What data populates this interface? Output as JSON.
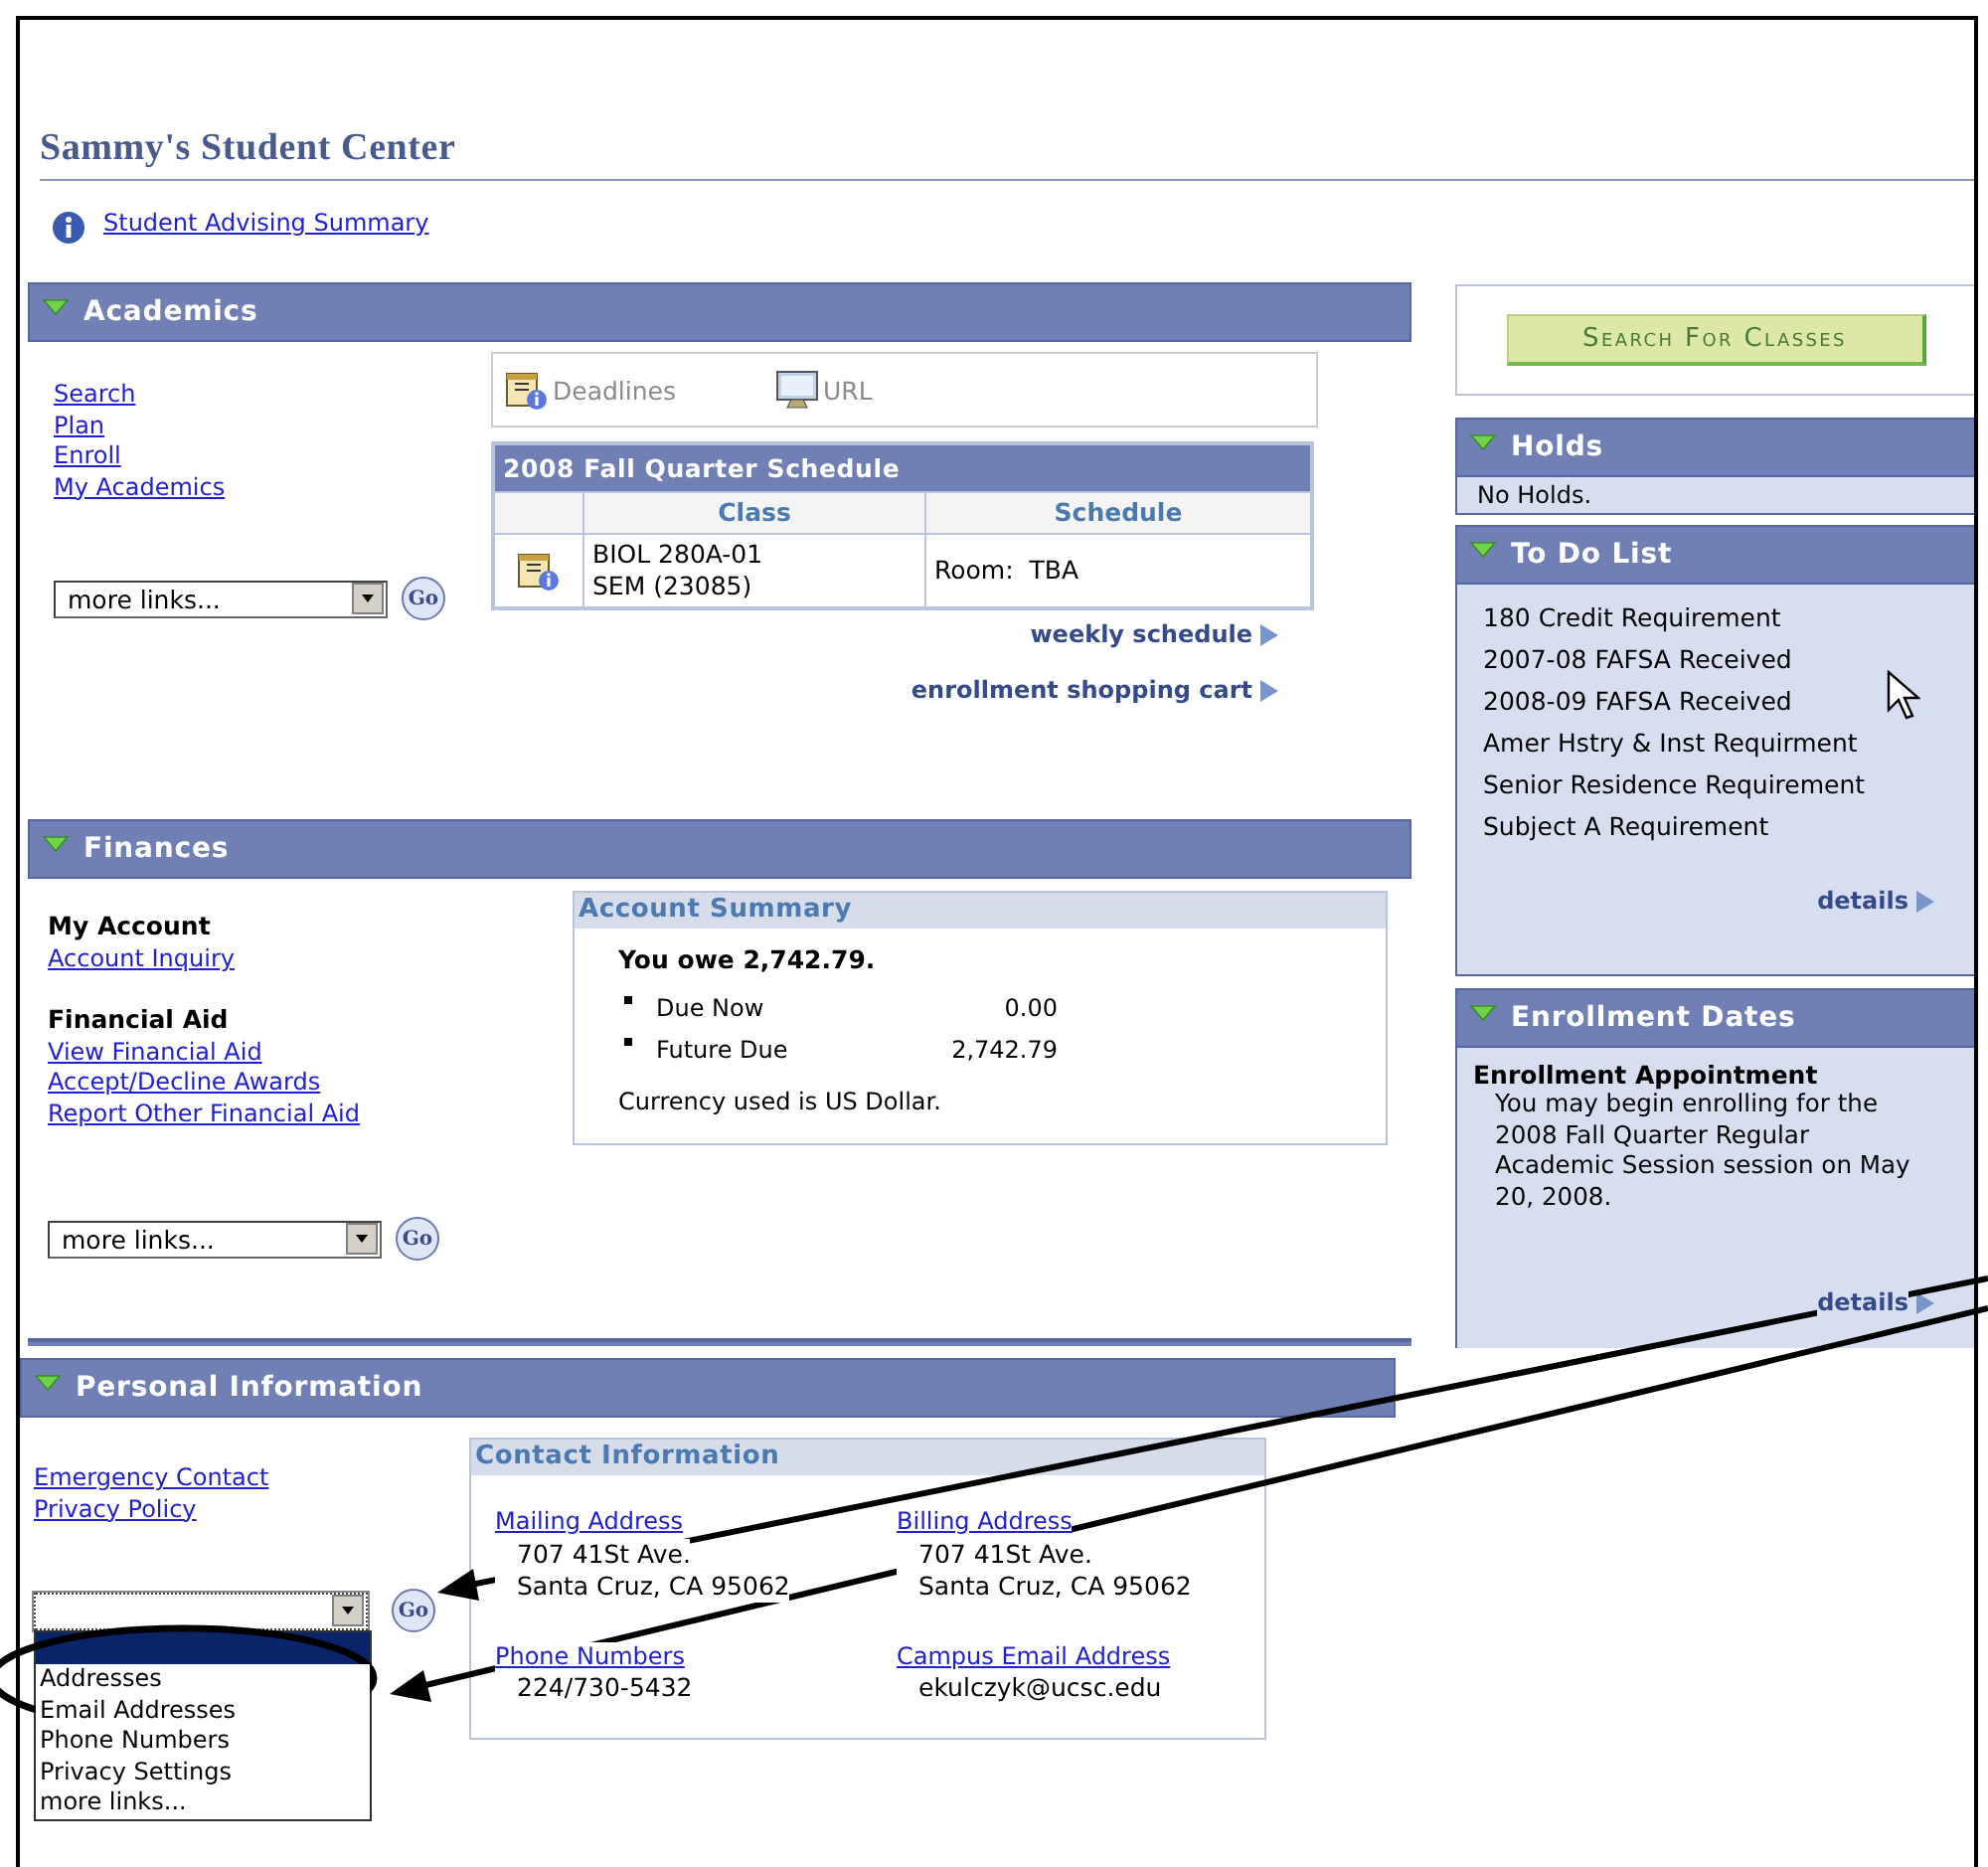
{
  "page_title": "Sammy's Student Center",
  "advising_link": "Student Advising Summary",
  "academics": {
    "title": "Academics",
    "expanded": true,
    "links": [
      "Search",
      "Plan",
      "Enroll",
      "My Academics"
    ],
    "more_links": "more links...",
    "go": "Go",
    "tools": [
      {
        "label": "Deadlines",
        "kind": "calendar"
      },
      {
        "label": "URL",
        "kind": "url"
      }
    ],
    "schedule": {
      "title": "2008 Fall Quarter Schedule",
      "columns": [
        "Class",
        "Schedule"
      ],
      "rows": [
        {
          "class": [
            "BIOL 280A-01",
            "SEM (23085)"
          ],
          "schedule": "Room:  TBA"
        }
      ]
    },
    "actions": [
      "weekly schedule",
      "enrollment shopping cart"
    ]
  },
  "finances": {
    "title": "Finances",
    "expanded": true,
    "groups": [
      {
        "heading": "My Account",
        "links": [
          "Account Inquiry"
        ]
      },
      {
        "heading": "Financial Aid",
        "links": [
          "View Financial Aid",
          "Accept/Decline Awards",
          "Report Other Financial Aid"
        ]
      }
    ],
    "more_links": "more links...",
    "go": "Go",
    "summary": {
      "title": "Account Summary",
      "owe": "You owe 2,742.79.",
      "items": [
        {
          "label": "Due Now",
          "amount": "0.00"
        },
        {
          "label": "Future Due",
          "amount": "2,742.79"
        }
      ],
      "note": "Currency used is US Dollar."
    }
  },
  "sidebar": {
    "search_button": "Search For Classes",
    "holds": {
      "title": "Holds",
      "expanded": true,
      "text": "No Holds."
    },
    "todo": {
      "title": "To Do List",
      "expanded": true,
      "items": [
        "180 Credit Requirement",
        "2007-08 FAFSA Received",
        "2008-09 FAFSA Received",
        "Amer Hstry & Inst Requirment",
        "Senior Residence Requirement",
        "Subject A Requirement"
      ],
      "details": "details"
    },
    "enrollment": {
      "title": "Enrollment Dates",
      "expanded": true,
      "heading": "Enrollment Appointment",
      "text": "You may begin enrolling for the 2008 Fall Quarter Regular Academic Session session on May 20, 2008.",
      "details": "details"
    }
  },
  "personal": {
    "title": "Personal Information",
    "expanded": true,
    "links": [
      "Emergency Contact",
      "Privacy Policy"
    ],
    "go": "Go",
    "dropdown": {
      "open": true,
      "blank_option_selected": true,
      "options": [
        {
          "label": "Addresses",
          "selected": false
        },
        {
          "label": "Email Addresses",
          "selected": false
        },
        {
          "label": "Phone Numbers",
          "selected": false
        },
        {
          "label": "Privacy Settings",
          "selected": false
        },
        {
          "label": "more links...",
          "selected": false
        }
      ]
    },
    "contact": {
      "title": "Contact Information",
      "entries": [
        {
          "label": "Mailing Address",
          "lines": [
            "707 41St Ave.",
            "Santa Cruz, CA 95062"
          ]
        },
        {
          "label": "Billing Address",
          "lines": [
            "707 41St Ave.",
            "Santa Cruz, CA 95062"
          ]
        },
        {
          "label": "Phone Numbers",
          "lines": [
            "224/730-5432"
          ]
        },
        {
          "label": "Campus Email Address",
          "lines": [
            "ekulczyk@ucsc.edu"
          ]
        }
      ]
    }
  }
}
